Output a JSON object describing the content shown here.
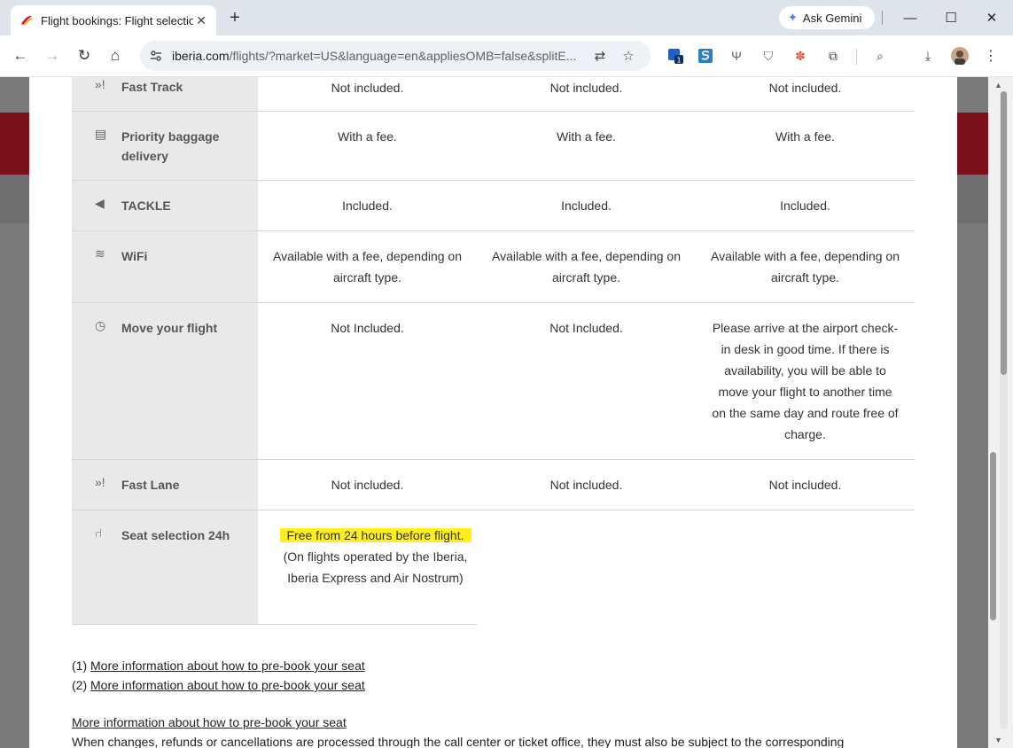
{
  "browser": {
    "tab_title": "Flight bookings: Flight selection",
    "gemini_label": "Ask Gemini",
    "url_host": "iberia.com",
    "url_rest": "/flights/?market=US&language=en&appliesOMB=false&splitE...",
    "extension_badge": "1"
  },
  "table": {
    "rows": [
      {
        "label": "Fast Track",
        "icon": "fast-track-icon",
        "glyph": "»",
        "values": [
          "Not included.",
          "Not included.",
          "Not included."
        ]
      },
      {
        "label": "Priority baggage delivery",
        "icon": "baggage-icon",
        "glyph": "▤",
        "values": [
          "With a fee.",
          "With a fee.",
          "With a fee."
        ]
      },
      {
        "label": "TACKLE",
        "icon": "tackle-icon",
        "glyph": "◀",
        "values": [
          "Included.",
          "Included.",
          "Included."
        ]
      },
      {
        "label": "WiFi",
        "icon": "wifi-icon",
        "glyph": "≋",
        "values": [
          "Available with a fee, depending on aircraft type.",
          "Available with a fee, depending on aircraft type.",
          "Available with a fee, depending on aircraft type."
        ]
      },
      {
        "label": "Move your flight",
        "icon": "clock-icon",
        "glyph": "◷",
        "values": [
          "Not Included.",
          "Not Included.",
          "Please arrive at the airport check-in desk in good time. If there is availability, you will be able to move your flight to another time on the same day and route free of charge."
        ]
      },
      {
        "label": "Fast Lane",
        "icon": "fast-lane-icon",
        "glyph": "»",
        "values": [
          "Not included.",
          "Not included.",
          "Not included."
        ]
      }
    ],
    "seat": {
      "label": "Seat selection 24h",
      "icon": "seat-icon",
      "highlight": "Free from 24 hours before flight.",
      "rest": "(On flights operated by the Iberia, Iberia Express and Air Nostrum)"
    }
  },
  "notes": {
    "n1_prefix": "(1)",
    "n2_prefix": "(2)",
    "link_text": "More information about how to pre-book your seat",
    "footer_link": "More information about how to pre-book your seat",
    "footer_text": "When changes, refunds or cancellations are processed through the call center or ticket office, they must also be subject to the corresponding"
  }
}
